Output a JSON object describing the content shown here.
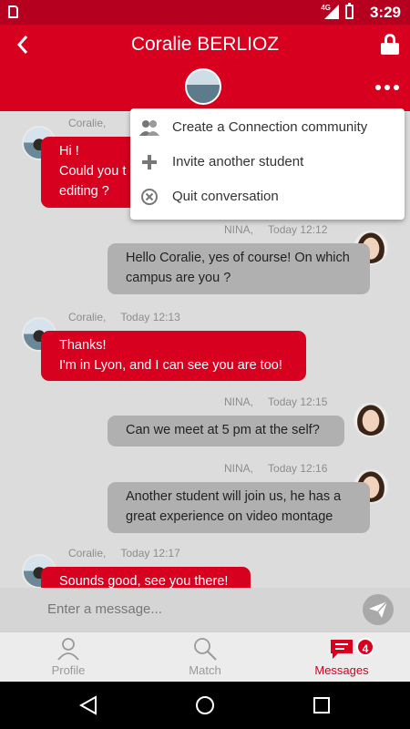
{
  "status_bar": {
    "network": "4G",
    "time": "3:29"
  },
  "header": {
    "title": "Coralie BERLIOZ",
    "more_label": "More options"
  },
  "menu": {
    "items": [
      {
        "label": "Create a Connection community",
        "icon": "group-icon"
      },
      {
        "label": "Invite another student",
        "icon": "plus-icon"
      },
      {
        "label": "Quit conversation",
        "icon": "close-circle-icon"
      }
    ]
  },
  "messages": [
    {
      "sender": "Coralie,",
      "time": "",
      "side": "left",
      "lines": [
        "Hi !",
        "Could you t",
        "editing ?"
      ]
    },
    {
      "sender": "NINA,",
      "time": "Today 12:12",
      "side": "right",
      "lines": [
        "Hello Coralie, yes of course! On which",
        "campus are you ?"
      ]
    },
    {
      "sender": "Coralie,",
      "time": "Today 12:13",
      "side": "left",
      "lines": [
        "Thanks!",
        "I'm in Lyon, and I can see you are too!"
      ]
    },
    {
      "sender": "NINA,",
      "time": "Today 12:15",
      "side": "right",
      "lines": [
        "Can we meet at 5 pm at the self?"
      ]
    },
    {
      "sender": "NINA,",
      "time": "Today 12:16",
      "side": "right",
      "lines": [
        "Another student will join us, he has a",
        "great experience on video montage"
      ]
    },
    {
      "sender": "Coralie,",
      "time": "Today 12:17",
      "side": "left",
      "lines": [
        "Sounds good, see you there!"
      ]
    }
  ],
  "composer": {
    "placeholder": "Enter a message..."
  },
  "tabs": [
    {
      "label": "Profile",
      "icon": "person-icon"
    },
    {
      "label": "Match",
      "icon": "search-icon"
    },
    {
      "label": "Messages",
      "icon": "chat-icon",
      "badge": "4"
    }
  ],
  "colors": {
    "accent": "#d7001f",
    "status_bar": "#b5001f",
    "bubble_grey": "#b0b0b0"
  }
}
